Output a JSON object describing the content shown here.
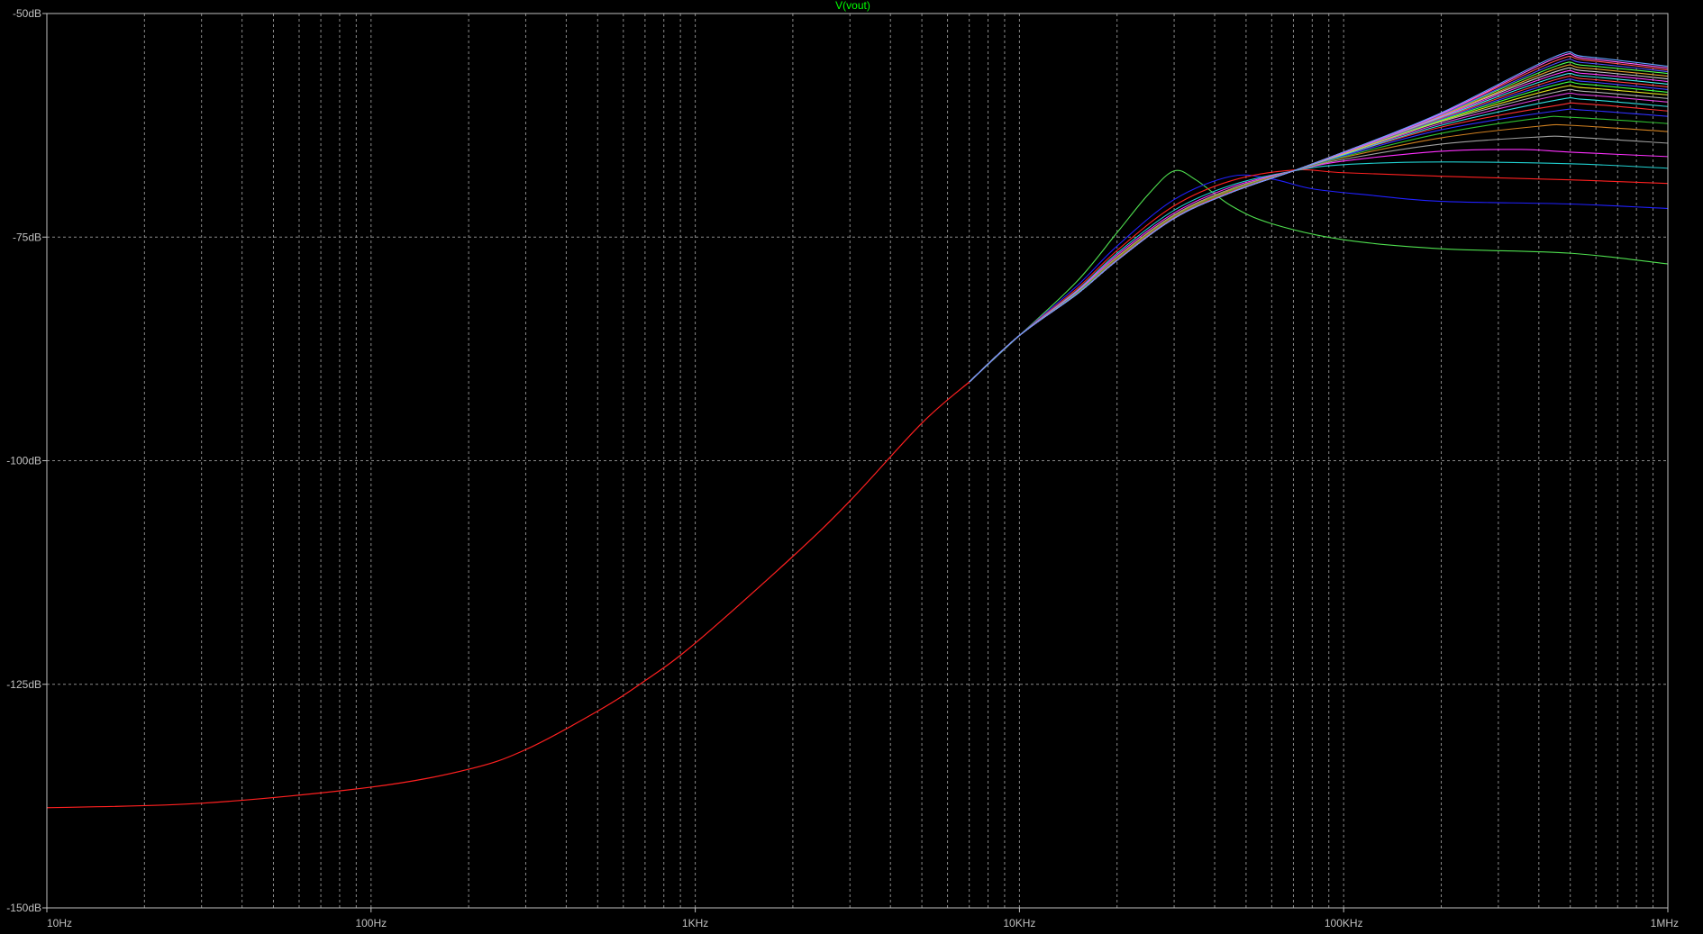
{
  "colors": {
    "background": "#000000",
    "grid": "#8a8a8a",
    "frame": "#c0c0c0",
    "tick_text": "#c0c0c0",
    "title": "#00ff00"
  },
  "chart_data": {
    "type": "line",
    "title": "V(vout)",
    "x_scale": "log",
    "xlim": [
      10,
      1000000
    ],
    "ylim": [
      -150,
      -50
    ],
    "grid": true,
    "x_ticks": [
      {
        "value": 10,
        "label": "10Hz"
      },
      {
        "value": 100,
        "label": "100Hz"
      },
      {
        "value": 1000,
        "label": "1KHz"
      },
      {
        "value": 10000,
        "label": "10KHz"
      },
      {
        "value": 100000,
        "label": "100KHz"
      },
      {
        "value": 1000000,
        "label": "1MHz"
      }
    ],
    "y_ticks": [
      {
        "value": -50,
        "label": "-50dB"
      },
      {
        "value": -75,
        "label": "-75dB"
      },
      {
        "value": -100,
        "label": "-100dB"
      },
      {
        "value": -125,
        "label": "-125dB"
      },
      {
        "value": -150,
        "label": "-150dB"
      }
    ],
    "common_curve": {
      "x": [
        10,
        30,
        100,
        200,
        300,
        500,
        700,
        1000,
        2000,
        3000,
        5000,
        7000
      ],
      "y": [
        -138.8,
        -138.3,
        -136.5,
        -134.5,
        -132.3,
        -128.0,
        -124.6,
        -120.4,
        -110.7,
        -104.5,
        -95.8,
        -91.2
      ]
    },
    "series": [
      {
        "color": "#4fe04f",
        "x": [
          7000,
          10000,
          15000,
          20000,
          25000,
          30000,
          35000,
          45000,
          60000,
          100000,
          200000,
          500000,
          1000000
        ],
        "y": [
          -91.2,
          -86.0,
          -80.0,
          -74.5,
          -70.2,
          -67.6,
          -68.6,
          -71.5,
          -73.5,
          -75.3,
          -76.3,
          -76.8,
          -78.0
        ]
      },
      {
        "color": "#2020ff",
        "x": [
          7000,
          10000,
          15000,
          20000,
          30000,
          45000,
          60000,
          80000,
          120000,
          200000,
          500000,
          1000000
        ],
        "y": [
          -91.2,
          -86.0,
          -80.5,
          -76.0,
          -70.8,
          -68.2,
          -68.5,
          -69.6,
          -70.3,
          -71.0,
          -71.3,
          -71.8
        ]
      },
      {
        "color": "#ff2020",
        "x": [
          7000,
          10000,
          15000,
          20000,
          30000,
          45000,
          70000,
          100000,
          200000,
          500000,
          1000000
        ],
        "y": [
          -91.2,
          -86.0,
          -80.8,
          -76.5,
          -71.5,
          -68.7,
          -67.5,
          -67.8,
          -68.2,
          -68.6,
          -69.0
        ]
      },
      {
        "color": "#20d0d0",
        "x": [
          7000,
          10000,
          15000,
          20000,
          30000,
          45000,
          70000,
          100000,
          200000,
          500000,
          1000000
        ],
        "y": [
          -91.2,
          -86.0,
          -81.0,
          -76.8,
          -72.0,
          -69.2,
          -67.6,
          -66.9,
          -66.6,
          -66.8,
          -67.3
        ]
      },
      {
        "color": "#ff30ff",
        "x": [
          7000,
          10000,
          15000,
          20000,
          30000,
          45000,
          70000,
          100000,
          200000,
          350000,
          500000,
          1000000
        ],
        "y": [
          -91.2,
          -86.0,
          -81.1,
          -77.0,
          -72.3,
          -69.4,
          -67.6,
          -66.5,
          -65.4,
          -65.2,
          -65.5,
          -66.0
        ]
      },
      {
        "color": "#a0a0a0",
        "x": [
          7000,
          10000,
          15000,
          20000,
          30000,
          45000,
          70000,
          100000,
          200000,
          400000,
          500000,
          1000000
        ],
        "y": [
          -91.2,
          -86.0,
          -81.2,
          -77.2,
          -72.5,
          -69.6,
          -67.6,
          -66.3,
          -64.6,
          -63.8,
          -63.8,
          -64.5
        ]
      },
      {
        "color": "#d08020",
        "x": [
          7000,
          10000,
          15000,
          20000,
          30000,
          45000,
          70000,
          100000,
          200000,
          400000,
          500000,
          1000000
        ],
        "y": [
          -91.2,
          -86.0,
          -81.3,
          -77.3,
          -72.6,
          -69.7,
          -67.6,
          -66.1,
          -63.9,
          -62.6,
          -62.5,
          -63.2
        ]
      },
      {
        "color": "#30c030",
        "x": [
          7000,
          10000,
          15000,
          20000,
          30000,
          45000,
          70000,
          100000,
          200000,
          400000,
          500000,
          1000000
        ],
        "y": [
          -91.2,
          -86.0,
          -81.3,
          -77.4,
          -72.7,
          -69.8,
          -67.6,
          -66.0,
          -63.4,
          -61.7,
          -61.6,
          -62.3
        ]
      },
      {
        "color": "#3030ff",
        "x": [
          7000,
          10000,
          15000,
          20000,
          30000,
          45000,
          70000,
          100000,
          200000,
          450000,
          550000,
          1000000
        ],
        "y": [
          -91.2,
          -86.0,
          -81.4,
          -77.5,
          -72.8,
          -69.9,
          -67.6,
          -65.9,
          -63.0,
          -60.9,
          -60.8,
          -61.5
        ]
      },
      {
        "color": "#ff3030",
        "x": [
          7000,
          10000,
          15000,
          20000,
          30000,
          45000,
          70000,
          100000,
          200000,
          450000,
          550000,
          1000000
        ],
        "y": [
          -91.2,
          -86.0,
          -81.4,
          -77.5,
          -72.8,
          -69.9,
          -67.6,
          -65.8,
          -62.7,
          -60.3,
          -60.1,
          -60.9
        ]
      },
      {
        "color": "#30e0e0",
        "x": [
          7000,
          10000,
          15000,
          20000,
          30000,
          45000,
          70000,
          100000,
          200000,
          450000,
          550000,
          1000000
        ],
        "y": [
          -91.2,
          -86.0,
          -81.4,
          -77.6,
          -72.9,
          -70.0,
          -67.6,
          -65.8,
          -62.5,
          -59.7,
          -59.6,
          -60.4
        ]
      },
      {
        "color": "#e040e0",
        "x": [
          7000,
          10000,
          15000,
          20000,
          30000,
          45000,
          70000,
          100000,
          200000,
          450000,
          550000,
          1000000
        ],
        "y": [
          -91.2,
          -86.0,
          -81.4,
          -77.6,
          -72.9,
          -70.0,
          -67.6,
          -65.7,
          -62.3,
          -59.2,
          -59.1,
          -59.9
        ]
      },
      {
        "color": "#b0b0b0",
        "x": [
          7000,
          10000,
          15000,
          20000,
          30000,
          45000,
          70000,
          100000,
          200000,
          450000,
          550000,
          1000000
        ],
        "y": [
          -91.2,
          -86.0,
          -81.4,
          -77.6,
          -72.9,
          -70.0,
          -67.6,
          -65.7,
          -62.1,
          -58.8,
          -58.7,
          -59.5
        ]
      },
      {
        "color": "#e0e020",
        "x": [
          7000,
          10000,
          15000,
          20000,
          30000,
          45000,
          70000,
          100000,
          200000,
          450000,
          550000,
          1000000
        ],
        "y": [
          -91.2,
          -86.0,
          -81.4,
          -77.6,
          -72.9,
          -70.0,
          -67.6,
          -65.7,
          -62.0,
          -58.4,
          -58.3,
          -59.1
        ]
      },
      {
        "color": "#40ff40",
        "x": [
          7000,
          10000,
          15000,
          20000,
          30000,
          45000,
          70000,
          100000,
          200000,
          450000,
          550000,
          1000000
        ],
        "y": [
          -91.2,
          -86.0,
          -81.4,
          -77.6,
          -72.9,
          -70.0,
          -67.6,
          -65.6,
          -61.9,
          -58.0,
          -57.9,
          -58.8
        ]
      },
      {
        "color": "#4040ff",
        "x": [
          7000,
          10000,
          15000,
          20000,
          30000,
          45000,
          70000,
          100000,
          200000,
          450000,
          550000,
          1000000
        ],
        "y": [
          -91.2,
          -86.0,
          -81.4,
          -77.6,
          -72.9,
          -70.0,
          -67.6,
          -65.6,
          -61.8,
          -57.7,
          -57.6,
          -58.5
        ]
      },
      {
        "color": "#ff4040",
        "x": [
          7000,
          10000,
          15000,
          20000,
          30000,
          45000,
          70000,
          100000,
          200000,
          450000,
          550000,
          1000000
        ],
        "y": [
          -91.2,
          -86.0,
          -81.4,
          -77.6,
          -72.9,
          -70.0,
          -67.6,
          -65.6,
          -61.7,
          -57.4,
          -57.3,
          -58.2
        ]
      },
      {
        "color": "#40f0f0",
        "x": [
          7000,
          10000,
          15000,
          20000,
          30000,
          45000,
          70000,
          100000,
          200000,
          450000,
          550000,
          1000000
        ],
        "y": [
          -91.2,
          -86.0,
          -81.4,
          -77.6,
          -72.9,
          -70.0,
          -67.6,
          -65.6,
          -61.6,
          -57.1,
          -57.0,
          -57.9
        ]
      },
      {
        "color": "#ff40ff",
        "x": [
          7000,
          10000,
          15000,
          20000,
          30000,
          45000,
          70000,
          100000,
          200000,
          450000,
          550000,
          1000000
        ],
        "y": [
          -91.2,
          -86.0,
          -81.4,
          -77.6,
          -72.9,
          -70.0,
          -67.6,
          -65.6,
          -61.5,
          -56.8,
          -56.7,
          -57.6
        ]
      },
      {
        "color": "#c8c8c8",
        "x": [
          7000,
          10000,
          15000,
          20000,
          30000,
          45000,
          70000,
          100000,
          200000,
          450000,
          550000,
          1000000
        ],
        "y": [
          -91.2,
          -86.0,
          -81.4,
          -77.6,
          -72.9,
          -70.0,
          -67.6,
          -65.5,
          -61.4,
          -56.5,
          -56.4,
          -57.3
        ]
      },
      {
        "color": "#e0a030",
        "x": [
          7000,
          10000,
          15000,
          20000,
          30000,
          45000,
          70000,
          100000,
          200000,
          450000,
          550000,
          1000000
        ],
        "y": [
          -91.2,
          -86.0,
          -81.4,
          -77.6,
          -72.9,
          -70.0,
          -67.6,
          -65.5,
          -61.4,
          -56.2,
          -56.1,
          -57.0
        ]
      },
      {
        "color": "#50ff50",
        "x": [
          7000,
          10000,
          15000,
          20000,
          30000,
          45000,
          70000,
          100000,
          200000,
          450000,
          550000,
          1000000
        ],
        "y": [
          -91.2,
          -86.0,
          -81.4,
          -77.6,
          -72.9,
          -70.0,
          -67.6,
          -65.5,
          -61.3,
          -55.9,
          -55.8,
          -56.7
        ]
      },
      {
        "color": "#5050ff",
        "x": [
          7000,
          10000,
          15000,
          20000,
          30000,
          45000,
          70000,
          100000,
          200000,
          450000,
          550000,
          1000000
        ],
        "y": [
          -91.2,
          -86.0,
          -81.4,
          -77.6,
          -72.9,
          -70.0,
          -67.6,
          -65.5,
          -61.3,
          -55.6,
          -55.5,
          -56.5
        ]
      },
      {
        "color": "#ff5050",
        "x": [
          7000,
          10000,
          15000,
          20000,
          30000,
          45000,
          70000,
          100000,
          200000,
          450000,
          550000,
          1000000
        ],
        "y": [
          -91.2,
          -86.0,
          -81.4,
          -77.6,
          -72.9,
          -70.0,
          -67.6,
          -65.5,
          -61.2,
          -55.3,
          -55.2,
          -56.3
        ]
      },
      {
        "color": "#ff60ff",
        "x": [
          7000,
          10000,
          15000,
          20000,
          30000,
          45000,
          70000,
          100000,
          200000,
          450000,
          550000,
          1000000
        ],
        "y": [
          -91.2,
          -86.0,
          -81.4,
          -77.6,
          -72.9,
          -70.0,
          -67.6,
          -65.5,
          -61.2,
          -55.0,
          -55.0,
          -56.1
        ]
      },
      {
        "color": "#60a0ff",
        "x": [
          7000,
          10000,
          15000,
          20000,
          30000,
          45000,
          70000,
          100000,
          200000,
          450000,
          550000,
          1000000
        ],
        "y": [
          -91.2,
          -86.0,
          -81.4,
          -77.6,
          -72.9,
          -70.0,
          -67.6,
          -65.5,
          -61.1,
          -54.8,
          -54.8,
          -55.9
        ]
      }
    ]
  }
}
